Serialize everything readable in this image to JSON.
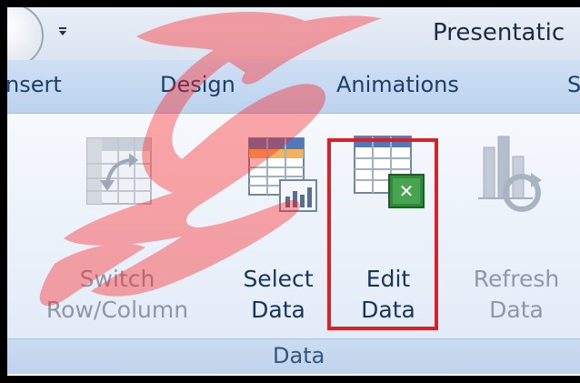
{
  "window": {
    "title": "Presentatic"
  },
  "quick_access": {
    "dropdown_icon": "customize-dropdown-icon"
  },
  "tabs": [
    {
      "label": "nsert"
    },
    {
      "label": "Design"
    },
    {
      "label": "Animations"
    },
    {
      "label": "S"
    }
  ],
  "ribbon": {
    "group_label": "Data",
    "buttons": [
      {
        "line1": "Switch",
        "line2": "Row/Column",
        "icon": "switch-row-column-icon",
        "state": "disabled"
      },
      {
        "line1": "Select",
        "line2": "Data",
        "icon": "select-data-icon",
        "state": "enabled"
      },
      {
        "line1": "Edit",
        "line2": "Data",
        "icon": "edit-data-excel-icon",
        "state": "enabled",
        "highlighted": true
      },
      {
        "line1": "Refresh",
        "line2": "Data",
        "icon": "refresh-data-icon",
        "state": "disabled"
      }
    ]
  },
  "colors": {
    "highlight": "#d9212a",
    "watermark": "#ff1a1a"
  }
}
